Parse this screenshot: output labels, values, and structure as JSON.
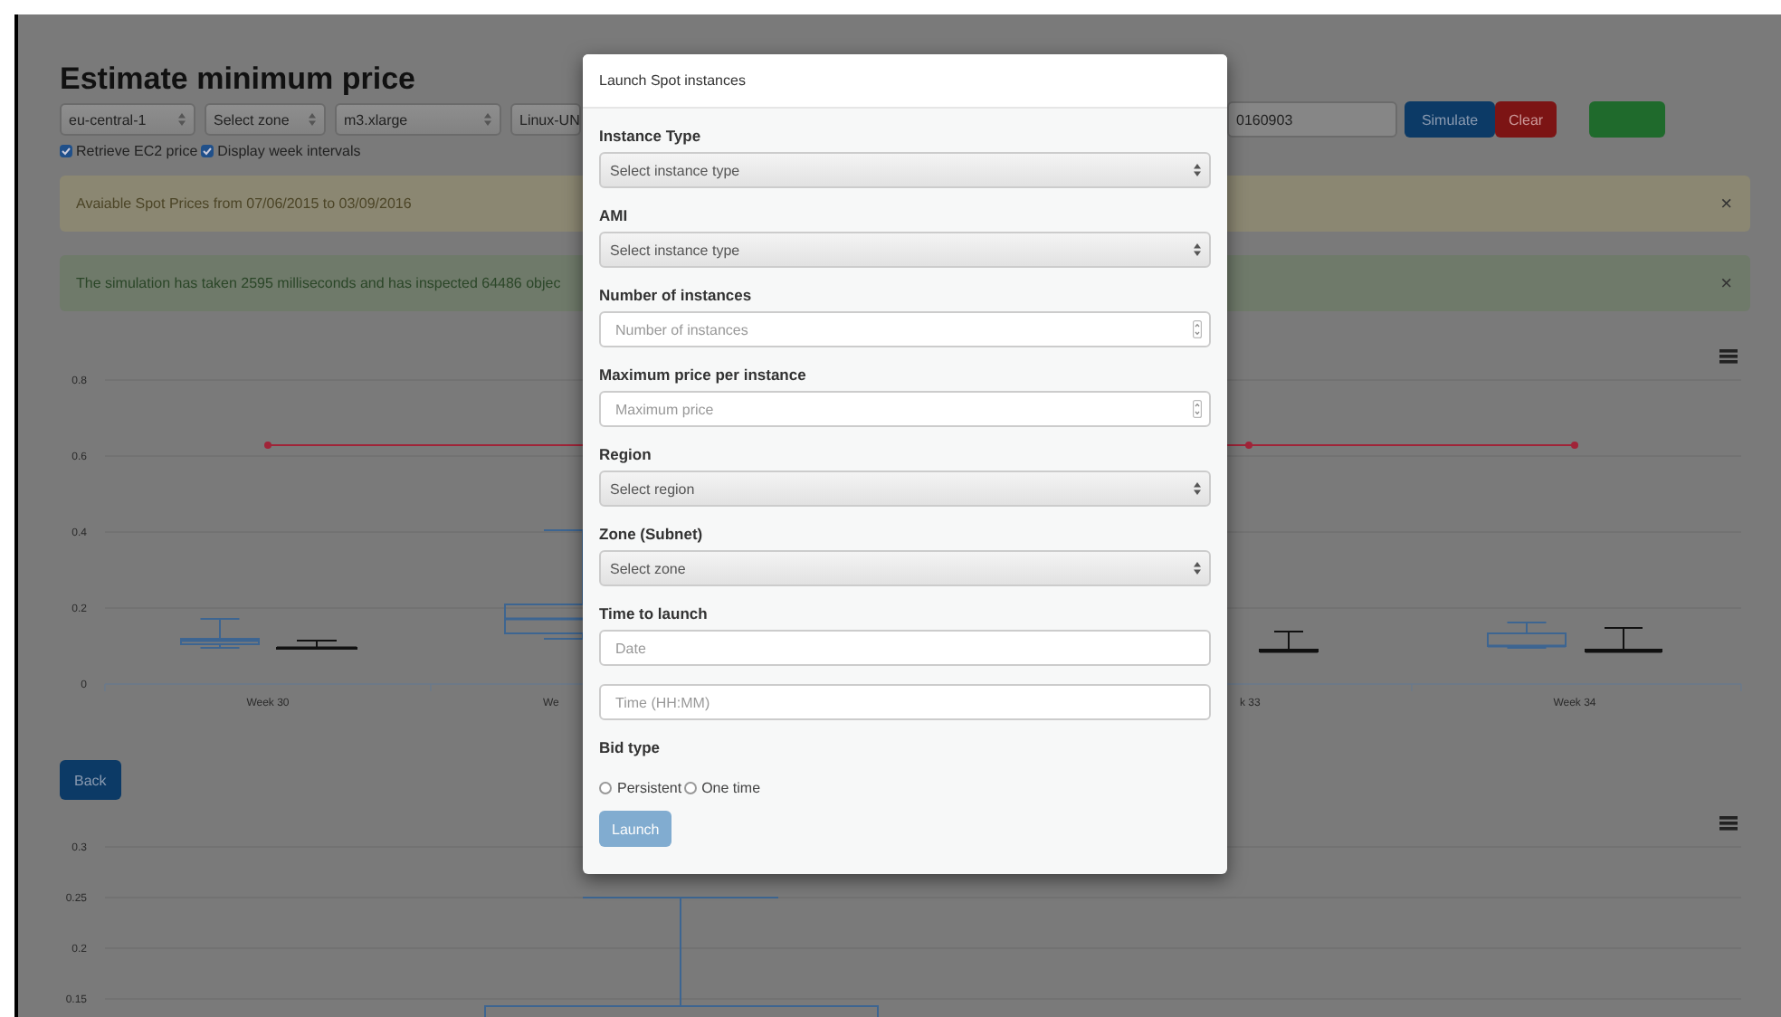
{
  "page": {
    "title": "Estimate minimum price",
    "toolbar": {
      "selects": [
        "eu-central-1",
        "Select zone",
        "m3.xlarge",
        "Linux-UN"
      ],
      "date_field": "0160903",
      "buttons": [
        {
          "label": "Simulate",
          "kind": "primary"
        },
        {
          "label": "Clear",
          "kind": "danger"
        },
        {
          "kind": "success"
        }
      ]
    },
    "checkboxes": [
      {
        "label": "Retrieve EC2 price",
        "checked": true
      },
      {
        "label": "Display week intervals",
        "checked": true
      }
    ],
    "alerts": [
      {
        "kind": "warning",
        "text": "Avaiable Spot Prices from 07/06/2015 to 03/09/2016",
        "close": "×"
      },
      {
        "kind": "success",
        "text": "The simulation has taken 2595 milliseconds and has inspected 64486 objec",
        "close": "×"
      }
    ],
    "charts": [
      {
        "kind": "weekly",
        "y_ticks": [
          "0.8",
          "0.6",
          "0.4",
          "0.2",
          "0"
        ],
        "x_labels": [
          "Week 30",
          "We",
          "k 33",
          "Week 34"
        ]
      },
      {
        "kind": "detail",
        "y_ticks": [
          "0.3",
          "0.25",
          "0.2",
          "0.15"
        ]
      }
    ],
    "back_button": "Back"
  },
  "modal": {
    "title": "Launch Spot instances",
    "groups": [
      {
        "label": "Instance Type",
        "controls": [
          {
            "kind": "select",
            "placeholder": "Select instance type"
          }
        ]
      },
      {
        "label": "AMI",
        "controls": [
          {
            "kind": "select",
            "placeholder": "Select instance type"
          }
        ]
      },
      {
        "label": "Number of instances",
        "controls": [
          {
            "kind": "number",
            "placeholder": "Number of instances"
          }
        ]
      },
      {
        "label": "Maximum price per instance",
        "controls": [
          {
            "kind": "number",
            "placeholder": "Maximum price"
          }
        ]
      },
      {
        "label": "Region",
        "controls": [
          {
            "kind": "select",
            "placeholder": "Select region"
          }
        ]
      },
      {
        "label": "Zone (Subnet)",
        "controls": [
          {
            "kind": "select",
            "placeholder": "Select zone"
          }
        ]
      },
      {
        "label": "Time to launch",
        "controls": [
          {
            "kind": "text",
            "placeholder": "Date"
          },
          {
            "kind": "text",
            "placeholder": "Time (HH:MM)"
          }
        ]
      }
    ],
    "bid_type": {
      "label": "Bid type",
      "options": [
        {
          "label": "Persistent",
          "selected": false
        },
        {
          "label": "One time",
          "selected": false
        }
      ]
    },
    "launch": {
      "label": "Launch",
      "disabled": true
    }
  }
}
